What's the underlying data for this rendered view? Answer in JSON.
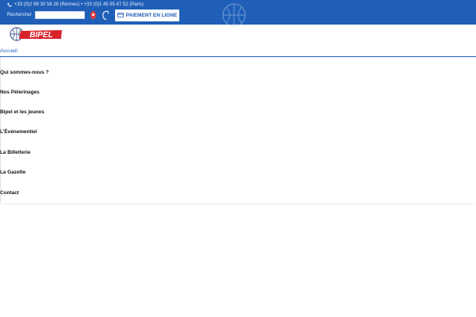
{
  "header": {
    "phone_text": "+33 (0)2 99 30 58 28 (Rennes) • +33 (0)1 45 55 47 52 (Paris)",
    "search_label": "Rechercher",
    "search_value": "",
    "pay_label": "PAIEMENT EN LIGNE",
    "bg_color": "#1f5fb8"
  },
  "logo": {
    "text": "BIPEL",
    "color": "#d9232b"
  },
  "nav": {
    "items": [
      {
        "label": "Accueil",
        "active": true
      },
      {
        "label": "Qui sommes-nous ?"
      },
      {
        "label": "Nos Pèlerinages"
      },
      {
        "label": "Bipel et les jeunes"
      },
      {
        "label": "L'Événementiel"
      },
      {
        "label": "La Billetterie"
      },
      {
        "label": "La Gazette"
      },
      {
        "label": "Contact"
      }
    ]
  },
  "icons": [
    "phone-icon",
    "location-pin-icon",
    "swirl-logo-icon",
    "credit-card-icon",
    "basketball-watermark-icon",
    "basketball-logo-icon"
  ]
}
